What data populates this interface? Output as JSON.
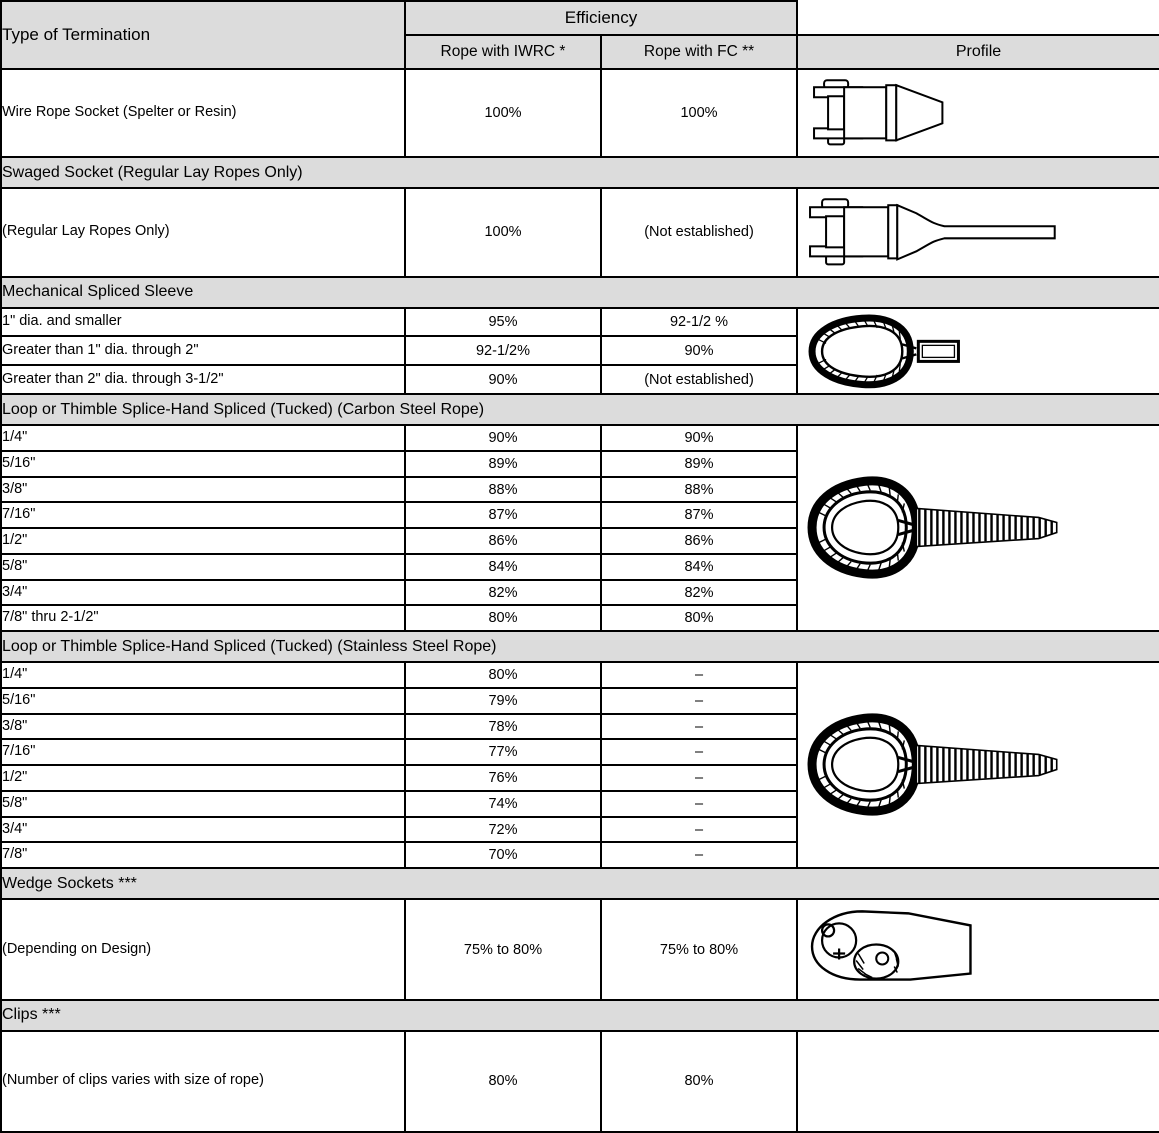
{
  "table": {
    "header": {
      "type_of_termination": "Type of Termination",
      "efficiency": "Efficiency",
      "rope_with_iwrc": "Rope with IWRC *",
      "rope_with_fc": "Rope with FC **",
      "profile": "Profile"
    },
    "colors": {
      "header_gray": "#dcdcdc",
      "border": "#000000",
      "cell_background": "#ffffff",
      "text": "#000000"
    },
    "sections": [
      {
        "band": null,
        "profile_icon": "wire-rope-socket-profile",
        "rows": [
          {
            "termination": "Wire Rope Socket (Spelter or Resin)",
            "iwrc": "100%",
            "fc": "100%"
          }
        ]
      },
      {
        "band": "Swaged Socket (Regular Lay Ropes Only)",
        "profile_icon": "swaged-socket-profile",
        "rows": [
          {
            "termination": "(Regular Lay Ropes Only)",
            "iwrc": "100%",
            "fc": "(Not established)"
          }
        ]
      },
      {
        "band": "Mechanical Spliced Sleeve",
        "profile_icon": "mechanical-spliced-sleeve-profile",
        "rows": [
          {
            "termination": "1\" dia. and smaller",
            "iwrc": "95%",
            "fc": "92-1/2 %"
          },
          {
            "termination": "Greater than 1\" dia. through 2\"",
            "iwrc": "92-1/2%",
            "fc": "90%"
          },
          {
            "termination": "Greater than 2\" dia. through 3-1/2\"",
            "iwrc": "90%",
            "fc": "(Not established)"
          }
        ]
      },
      {
        "band": "Loop or Thimble Splice-Hand Spliced (Tucked) (Carbon Steel Rope)",
        "profile_icon": "thimble-splice-carbon-profile",
        "rows": [
          {
            "termination": "1/4\"",
            "iwrc": "90%",
            "fc": "90%"
          },
          {
            "termination": "5/16\"",
            "iwrc": "89%",
            "fc": "89%"
          },
          {
            "termination": "3/8\"",
            "iwrc": "88%",
            "fc": "88%"
          },
          {
            "termination": "7/16\"",
            "iwrc": "87%",
            "fc": "87%"
          },
          {
            "termination": "1/2\"",
            "iwrc": "86%",
            "fc": "86%"
          },
          {
            "termination": "5/8\"",
            "iwrc": "84%",
            "fc": "84%"
          },
          {
            "termination": "3/4\"",
            "iwrc": "82%",
            "fc": "82%"
          },
          {
            "termination": "7/8\" thru 2-1/2\"",
            "iwrc": "80%",
            "fc": "80%"
          }
        ]
      },
      {
        "band": "Loop or Thimble Splice-Hand Spliced (Tucked) (Stainless Steel Rope)",
        "profile_icon": "thimble-splice-stainless-profile",
        "rows": [
          {
            "termination": "1/4\"",
            "iwrc": "80%",
            "fc": "–"
          },
          {
            "termination": "5/16\"",
            "iwrc": "79%",
            "fc": "–"
          },
          {
            "termination": "3/8\"",
            "iwrc": "78%",
            "fc": "–"
          },
          {
            "termination": "7/16\"",
            "iwrc": "77%",
            "fc": "–"
          },
          {
            "termination": "1/2\"",
            "iwrc": "76%",
            "fc": "–"
          },
          {
            "termination": "5/8\"",
            "iwrc": "74%",
            "fc": "–"
          },
          {
            "termination": "3/4\"",
            "iwrc": "72%",
            "fc": "–"
          },
          {
            "termination": "7/8\"",
            "iwrc": "70%",
            "fc": "–"
          }
        ]
      },
      {
        "band": "Wedge Sockets ***",
        "profile_icon": "wedge-socket-profile",
        "rows": [
          {
            "termination": "(Depending on Design)",
            "iwrc": "75% to 80%",
            "fc": "75% to 80%"
          }
        ]
      },
      {
        "band": "Clips ***",
        "profile_icon": "clips-profile",
        "rows": [
          {
            "termination": "(Number of clips varies with size of rope)",
            "iwrc": "80%",
            "fc": "80%"
          }
        ]
      }
    ]
  }
}
